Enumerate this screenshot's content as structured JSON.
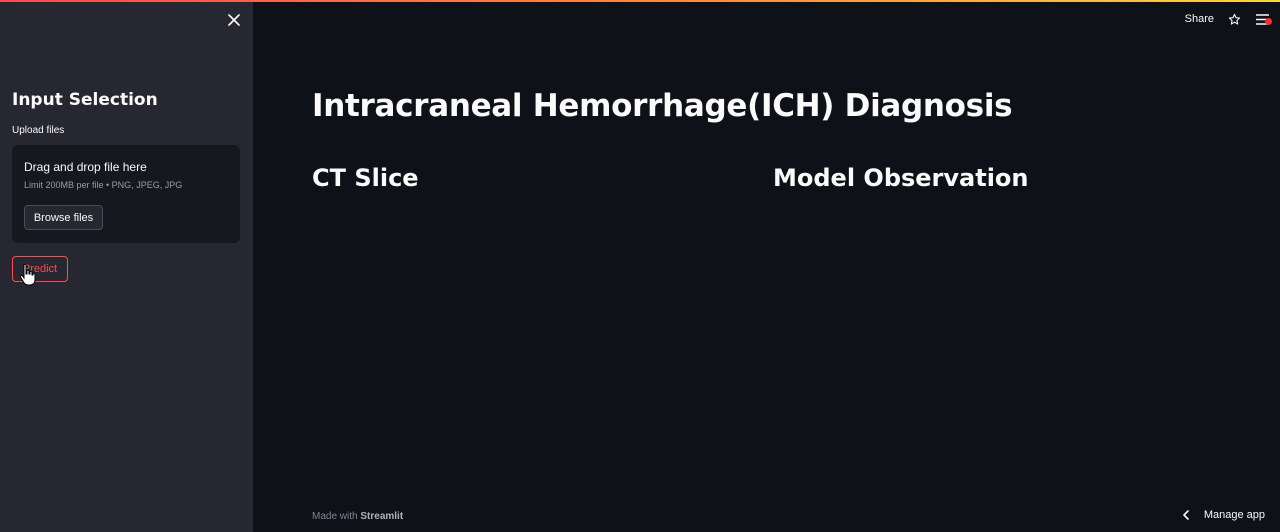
{
  "sidebar": {
    "title": "Input Selection",
    "upload_label": "Upload files",
    "dropzone": {
      "title": "Drag and drop file here",
      "limit": "Limit 200MB per file • PNG, JPEG, JPG",
      "browse_label": "Browse files"
    },
    "predict_label": "Predict"
  },
  "header": {
    "share_label": "Share"
  },
  "main": {
    "title": "Intracraneal Hemorrhage(ICH) Diagnosis",
    "col_left_title": "CT Slice",
    "col_right_title": "Model Observation"
  },
  "footer": {
    "made_with": "Made with",
    "brand": "Streamlit"
  },
  "manage_app_label": "Manage app",
  "colors": {
    "background": "#0e1117",
    "sidebar": "#262730",
    "accent": "#ff4b4b"
  },
  "icons": [
    "close-icon",
    "star-icon",
    "hamburger-menu-icon",
    "chevron-left-icon",
    "hand-cursor-icon"
  ]
}
